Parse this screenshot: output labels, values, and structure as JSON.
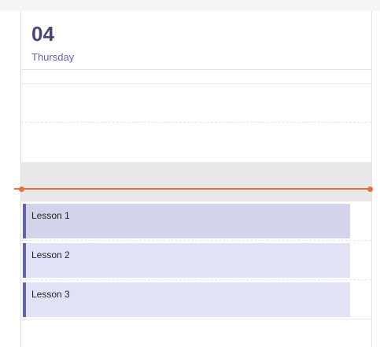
{
  "day": {
    "number": "04",
    "name": "Thursday"
  },
  "events": [
    {
      "title": "Lesson 1",
      "selected": true
    },
    {
      "title": "Lesson 2",
      "selected": false
    },
    {
      "title": "Lesson 3",
      "selected": false
    }
  ],
  "colors": {
    "accent": "#6264a7",
    "day_number": "#464775",
    "current_time": "#e8703f",
    "event_fill": "#e2e2f6",
    "event_fill_selected": "#d3d4ec",
    "busy_block": "#e8e8e8"
  }
}
